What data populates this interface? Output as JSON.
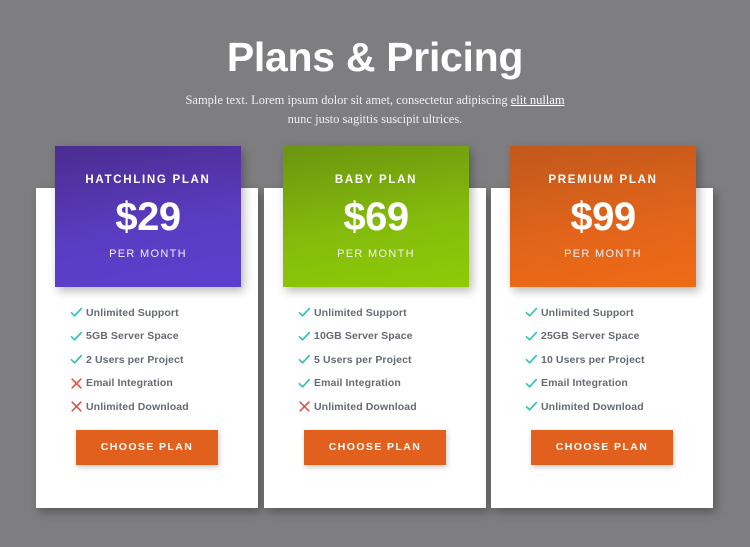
{
  "header": {
    "title": "Plans & Pricing",
    "subtitle_before": "Sample text. Lorem ipsum dolor sit amet, consectetur adipiscing ",
    "subtitle_link": "elit nullam",
    "subtitle_line2": "nunc justo sagittis suscipit ultrices."
  },
  "colors": {
    "background": "#7e7e80",
    "card_background": "#ffffff",
    "plan_1_accent": "#5b3dc4",
    "plan_2_accent": "#8ecb06",
    "plan_3_accent": "#e3651a",
    "cta": "#e1601e",
    "check": "#2ec4b6",
    "cross": "#e2574c",
    "feature_text": "#656b72"
  },
  "icons": {
    "check": "check-icon",
    "cross": "cross-icon"
  },
  "plans": [
    {
      "name": "Hatchling Plan",
      "price": "$29",
      "period": "Per Month",
      "cta_label": "Choose Plan",
      "features": [
        {
          "label": "Unlimited Support",
          "included": true
        },
        {
          "label": "5GB Server Space",
          "included": true
        },
        {
          "label": "2 Users per Project",
          "included": true
        },
        {
          "label": "Email Integration",
          "included": false
        },
        {
          "label": "Unlimited Download",
          "included": false
        }
      ]
    },
    {
      "name": "Baby Plan",
      "price": "$69",
      "period": "Per Month",
      "cta_label": "Choose Plan",
      "features": [
        {
          "label": "Unlimited Support",
          "included": true
        },
        {
          "label": "10GB Server Space",
          "included": true
        },
        {
          "label": "5 Users per Project",
          "included": true
        },
        {
          "label": "Email Integration",
          "included": true
        },
        {
          "label": "Unlimited Download",
          "included": false
        }
      ]
    },
    {
      "name": "Premium Plan",
      "price": "$99",
      "period": "Per Month",
      "cta_label": "Choose Plan",
      "features": [
        {
          "label": "Unlimited Support",
          "included": true
        },
        {
          "label": "25GB Server Space",
          "included": true
        },
        {
          "label": "10 Users per Project",
          "included": true
        },
        {
          "label": "Email Integration",
          "included": true
        },
        {
          "label": "Unlimited Download",
          "included": true
        }
      ]
    }
  ]
}
